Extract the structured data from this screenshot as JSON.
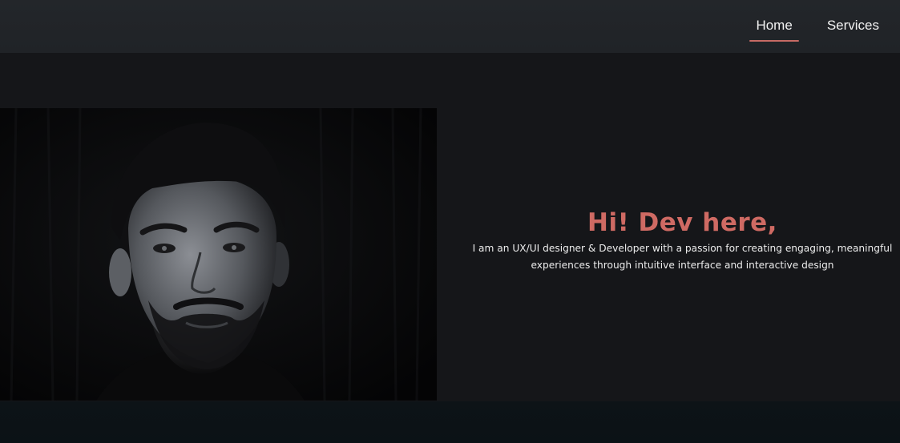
{
  "nav": {
    "items": [
      {
        "label": "Home",
        "active": true
      },
      {
        "label": "Services",
        "active": false
      }
    ]
  },
  "hero": {
    "greeting": "Hi! Dev here,",
    "intro_line1": "I am an UX/UI designer & Developer with a passion for creating engaging, meaningful",
    "intro_line2": "experiences through intuitive interface and interactive design"
  },
  "colors": {
    "accent": "#cf6a63",
    "header_bg": "#222529",
    "page_bg": "#151619"
  }
}
